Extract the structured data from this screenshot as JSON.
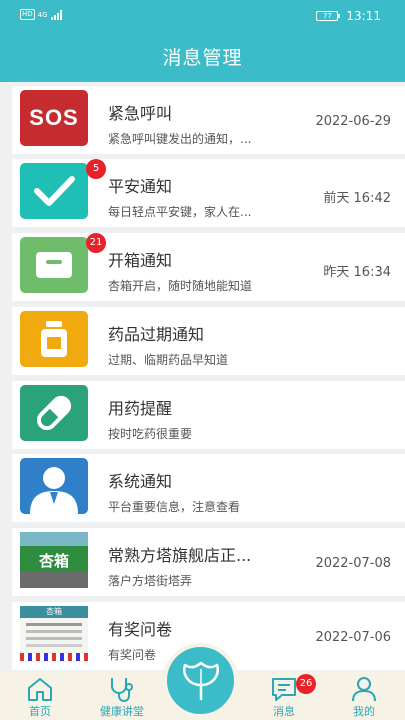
{
  "status_bar": {
    "network": "HD",
    "signal_label": "4G",
    "battery": "77",
    "time": "13:11"
  },
  "header": {
    "title": "消息管理"
  },
  "messages": [
    {
      "title": "紧急呼叫",
      "subtitle": "紧急呼叫键发出的通知，...",
      "time": "2022-06-29",
      "icon": "sos-icon",
      "icon_text": "SOS",
      "color": "#c62b2f"
    },
    {
      "title": "平安通知",
      "subtitle": "每日轻点平安键，家人在...",
      "time": "前天  16:42",
      "icon": "checkmark-icon",
      "color": "#1fbfb5",
      "badge": "5"
    },
    {
      "title": "开箱通知",
      "subtitle": "杏箱开启，随时随地能知道",
      "time": "昨天  16:34",
      "icon": "box-icon",
      "color": "#6fbd6a",
      "badge": "21"
    },
    {
      "title": "药品过期通知",
      "subtitle": "过期、临期药品早知道",
      "time": "",
      "icon": "medicine-bottle-icon",
      "color": "#f0aa10"
    },
    {
      "title": "用药提醒",
      "subtitle": "按时吃药很重要",
      "time": "",
      "icon": "pill-icon",
      "color": "#2aa37a"
    },
    {
      "title": "系统通知",
      "subtitle": "平台重要信息，注意查看",
      "time": "",
      "icon": "user-icon",
      "color": "#2f7fc9"
    },
    {
      "title": "常熟方塔旗舰店正...",
      "subtitle": "落户方塔街塔弄",
      "time": "2022-07-08",
      "icon": "store-photo-icon",
      "photo_text": "杏箱"
    },
    {
      "title": "有奖问卷",
      "subtitle": "有奖问卷",
      "time": "2022-07-06",
      "icon": "survey-photo-icon",
      "photo_text": "杏箱"
    }
  ],
  "tab_bar": {
    "tabs": [
      {
        "label": "首页",
        "icon": "home-icon"
      },
      {
        "label": "健康讲堂",
        "icon": "stethoscope-icon"
      },
      {
        "label": "消息",
        "icon": "message-icon",
        "badge": "26"
      },
      {
        "label": "我的",
        "icon": "person-icon"
      }
    ],
    "center_icon": "ginkgo-leaf-icon"
  },
  "colors": {
    "primary": "#3bbcc8",
    "badge": "#e8222a",
    "tab_bg": "#f6f2e6"
  }
}
